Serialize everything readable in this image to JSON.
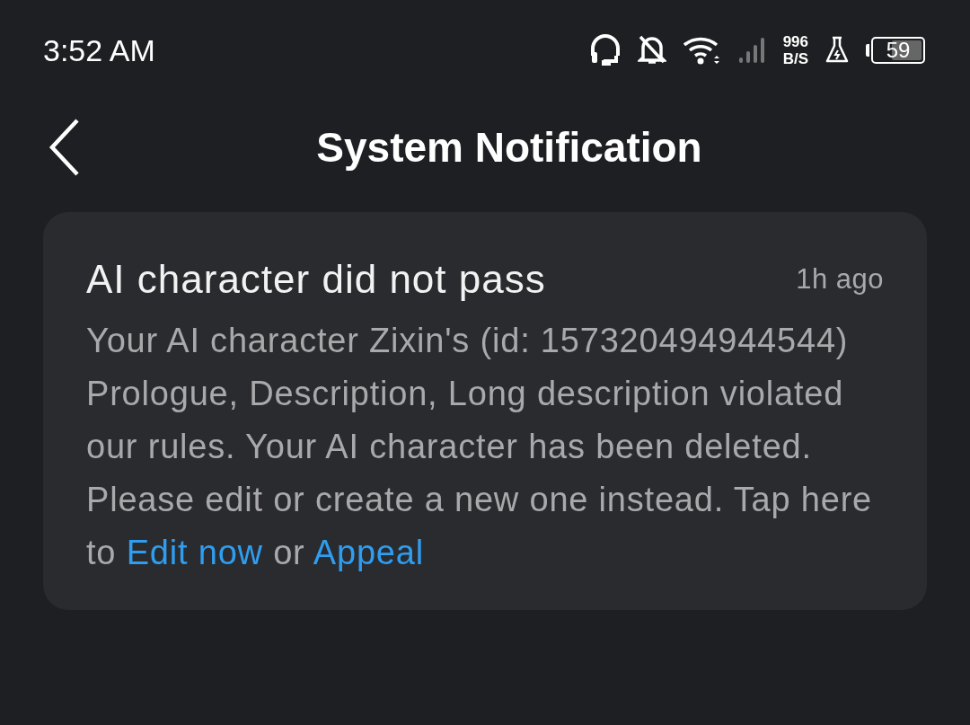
{
  "status_bar": {
    "time": "3:52 AM",
    "speed_value": "996",
    "speed_unit": "B/S",
    "battery": "59"
  },
  "header": {
    "title": "System Notification"
  },
  "notifications": [
    {
      "title": "AI character did not pass",
      "time": "1h ago",
      "body": [
        {
          "kind": "text",
          "text": "Your AI character Zixin's (id: 157320494944544) Prologue, Description, Long description violated our rules. Your AI character has been deleted. Please edit or create a new one instead. Tap here to "
        },
        {
          "kind": "link",
          "text": "Edit now"
        },
        {
          "kind": "text",
          "text": " or "
        },
        {
          "kind": "link",
          "text": "Appeal"
        }
      ]
    }
  ]
}
